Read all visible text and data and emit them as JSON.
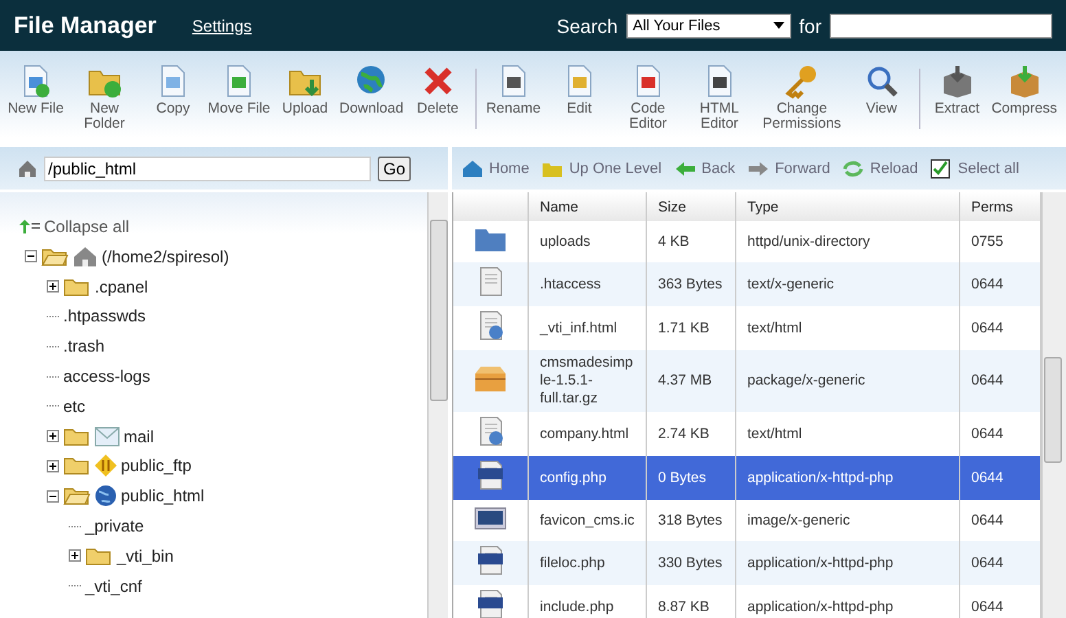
{
  "header": {
    "title": "File Manager",
    "settings_link": "Settings",
    "search_label": "Search",
    "search_scope": "All Your Files",
    "for_label": "for"
  },
  "toolbar": {
    "groups": [
      [
        {
          "label": "New File",
          "kind": "newfile"
        },
        {
          "label": "New Folder",
          "kind": "newfolder"
        },
        {
          "label": "Copy",
          "kind": "copy"
        },
        {
          "label": "Move File",
          "kind": "move"
        },
        {
          "label": "Upload",
          "kind": "upload"
        },
        {
          "label": "Download",
          "kind": "download"
        },
        {
          "label": "Delete",
          "kind": "delete"
        }
      ],
      [
        {
          "label": "Rename",
          "kind": "rename"
        },
        {
          "label": "Edit",
          "kind": "edit"
        },
        {
          "label": "Code Editor",
          "kind": "code"
        },
        {
          "label": "HTML Editor",
          "kind": "html"
        },
        {
          "label": "Change Permissions",
          "kind": "key"
        },
        {
          "label": "View",
          "kind": "view"
        }
      ],
      [
        {
          "label": "Extract",
          "kind": "extract"
        },
        {
          "label": "Compress",
          "kind": "compress"
        }
      ]
    ]
  },
  "path_bar": {
    "value": "/public_html",
    "go_button": "Go"
  },
  "nav": [
    {
      "label": "Home",
      "kind": "home"
    },
    {
      "label": "Up One Level",
      "kind": "up"
    },
    {
      "label": "Back",
      "kind": "back"
    },
    {
      "label": "Forward",
      "kind": "forward"
    },
    {
      "label": "Reload",
      "kind": "reload"
    },
    {
      "label": "Select all",
      "kind": "check"
    }
  ],
  "tree": {
    "collapse_all": "Collapse all",
    "items": [
      {
        "label": "(/home2/spiresol)",
        "kind": "home",
        "expanded": true,
        "children": [
          {
            "label": ".cpanel",
            "kind": "folder",
            "expanded": false
          },
          {
            "label": ".htpasswds"
          },
          {
            "label": ".trash"
          },
          {
            "label": "access-logs"
          },
          {
            "label": "etc"
          },
          {
            "label": "mail",
            "kind": "mail",
            "expanded": false
          },
          {
            "label": "public_ftp",
            "kind": "ftp",
            "expanded": false
          },
          {
            "label": "public_html",
            "kind": "globe",
            "expanded": true,
            "children": [
              {
                "label": "_private"
              },
              {
                "label": "_vti_bin",
                "kind": "folder",
                "expanded": false
              },
              {
                "label": "_vti_cnf"
              }
            ]
          }
        ]
      }
    ]
  },
  "table": {
    "columns": [
      "Name",
      "Size",
      "Type",
      "Perms"
    ],
    "rows": [
      {
        "kind": "folder",
        "name": "uploads",
        "size": "4 KB",
        "type": "httpd/unix-directory",
        "perms": "0755",
        "selected": false
      },
      {
        "kind": "text",
        "name": ".htaccess",
        "size": "363 Bytes",
        "type": "text/x-generic",
        "perms": "0644",
        "selected": false
      },
      {
        "kind": "html",
        "name": "_vti_inf.html",
        "size": "1.71 KB",
        "type": "text/html",
        "perms": "0644",
        "selected": false
      },
      {
        "kind": "package",
        "name": "cmsmadesimple-1.5.1-full.tar.gz",
        "size": "4.37 MB",
        "type": "package/x-generic",
        "perms": "0644",
        "selected": false
      },
      {
        "kind": "html",
        "name": "company.html",
        "size": "2.74 KB",
        "type": "text/html",
        "perms": "0644",
        "selected": false
      },
      {
        "kind": "php",
        "name": "config.php",
        "size": "0 Bytes",
        "type": "application/x-httpd-php",
        "perms": "0644",
        "selected": true
      },
      {
        "kind": "image",
        "name": "favicon_cms.ic",
        "size": "318 Bytes",
        "type": "image/x-generic",
        "perms": "0644",
        "selected": false
      },
      {
        "kind": "php",
        "name": "fileloc.php",
        "size": "330 Bytes",
        "type": "application/x-httpd-php",
        "perms": "0644",
        "selected": false
      },
      {
        "kind": "php",
        "name": "include.php",
        "size": "8.87 KB",
        "type": "application/x-httpd-php",
        "perms": "0644",
        "selected": false
      }
    ]
  }
}
